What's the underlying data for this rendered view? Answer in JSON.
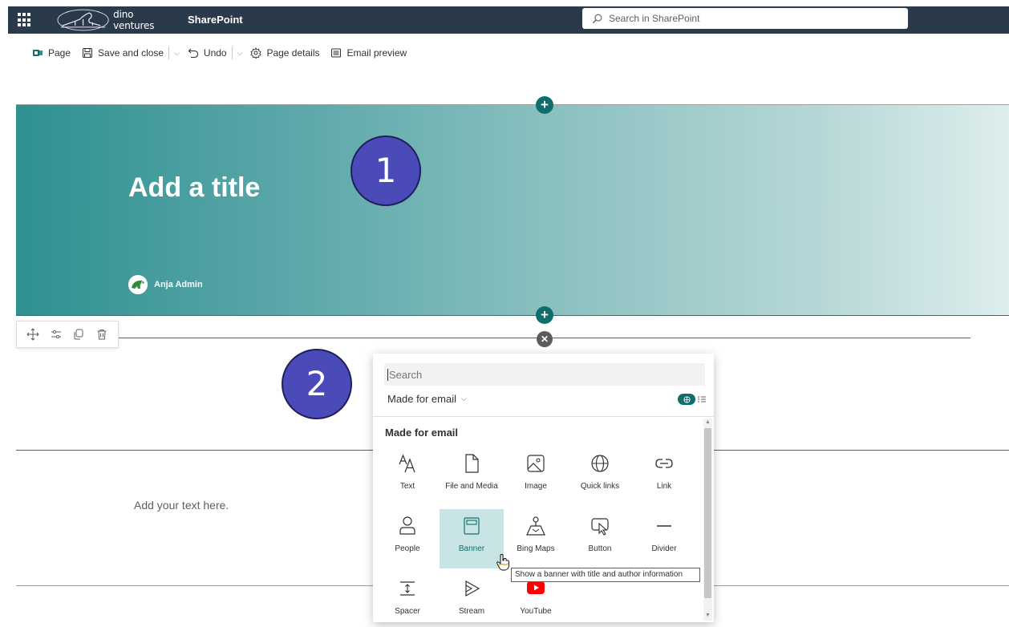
{
  "suitebar": {
    "logo_text": "dino ventures",
    "app_name": "SharePoint",
    "search_placeholder": "Search in SharePoint"
  },
  "commandbar": {
    "page": "Page",
    "save_close": "Save and close",
    "undo": "Undo",
    "page_details": "Page details",
    "email_preview": "Email preview"
  },
  "hero": {
    "title": "Add a title",
    "author": "Anja Admin"
  },
  "callouts": [
    "1",
    "2"
  ],
  "text_section": {
    "placeholder": "Add your text here."
  },
  "toolbox": {
    "search_placeholder": "Search",
    "filter": "Made for email",
    "heading": "Made for email",
    "items": [
      {
        "label": "Text",
        "icon": "text-icon"
      },
      {
        "label": "File and Media",
        "icon": "file-icon"
      },
      {
        "label": "Image",
        "icon": "image-icon"
      },
      {
        "label": "Quick links",
        "icon": "globe-icon"
      },
      {
        "label": "Link",
        "icon": "link-icon"
      },
      {
        "label": "People",
        "icon": "person-icon"
      },
      {
        "label": "Banner",
        "icon": "banner-icon",
        "selected": true
      },
      {
        "label": "Bing Maps",
        "icon": "map-pin-icon"
      },
      {
        "label": "Button",
        "icon": "button-icon"
      },
      {
        "label": "Divider",
        "icon": "divider-icon"
      },
      {
        "label": "Spacer",
        "icon": "spacer-icon"
      },
      {
        "label": "Stream",
        "icon": "stream-icon"
      },
      {
        "label": "YouTube",
        "icon": "youtube-icon"
      }
    ],
    "tooltip": "Show a banner with title and author information"
  },
  "colors": {
    "suitebar": "#2b3a4a",
    "accent": "#0f6e6c",
    "callout": "#4a4ab8",
    "selected_tile": "#c8e4e4"
  }
}
